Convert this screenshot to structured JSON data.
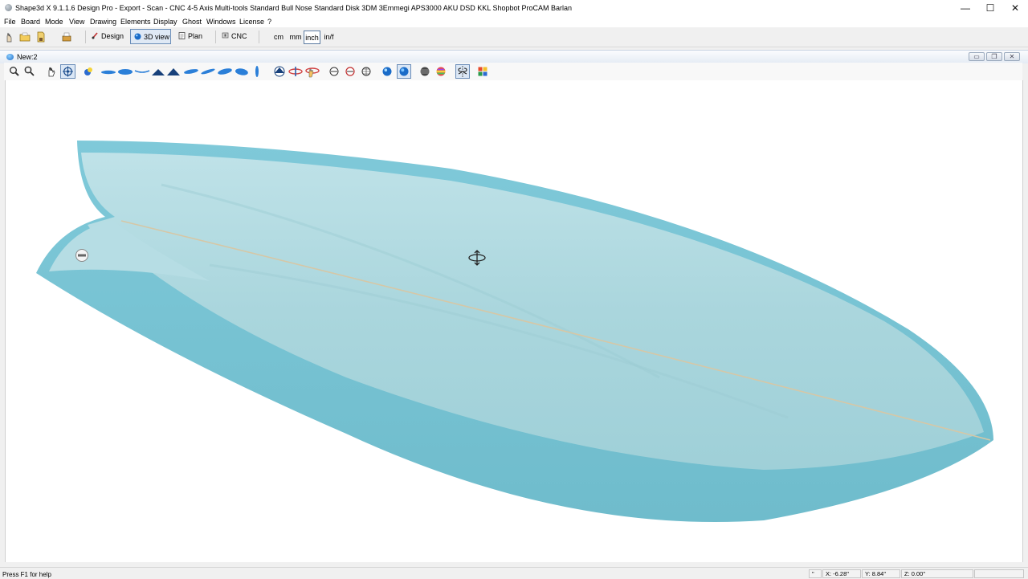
{
  "window": {
    "title": "Shape3d X 9.1.1.6 Design Pro - Export - Scan - CNC 4-5 Axis Multi-tools  Standard Bull Nose Standard Disk 3DM 3Emmegi APS3000 AKU DSD KKL Shopbot ProCAM Barlan",
    "minimize": "—",
    "maximize": "☐",
    "close": "✕"
  },
  "menu": [
    "File",
    "Board",
    "Mode",
    "View",
    "Drawing",
    "Elements",
    "Display",
    "Ghost",
    "Windows",
    "License",
    "?"
  ],
  "toolbar": {
    "modes": [
      "Design",
      "3D view",
      "Plan",
      "CNC"
    ],
    "active_mode": "3D view",
    "units": [
      "cm",
      "mm",
      "inch",
      "in/f"
    ],
    "active_unit": "inch"
  },
  "document": {
    "title": "New:2",
    "minimize": "▭",
    "restore": "❐",
    "close": "✕"
  },
  "status": {
    "help": "Press F1 for help",
    "unit_mark": "\"",
    "x": "X: -6.28\"",
    "y": "Y: 8.84\"",
    "z": "Z: 0.00\""
  },
  "colors": {
    "board_top": "#a8d8e0",
    "board_rail": "#7ec8d8",
    "stringer": "#d8c8a8",
    "accent": "#1b6cc8"
  }
}
